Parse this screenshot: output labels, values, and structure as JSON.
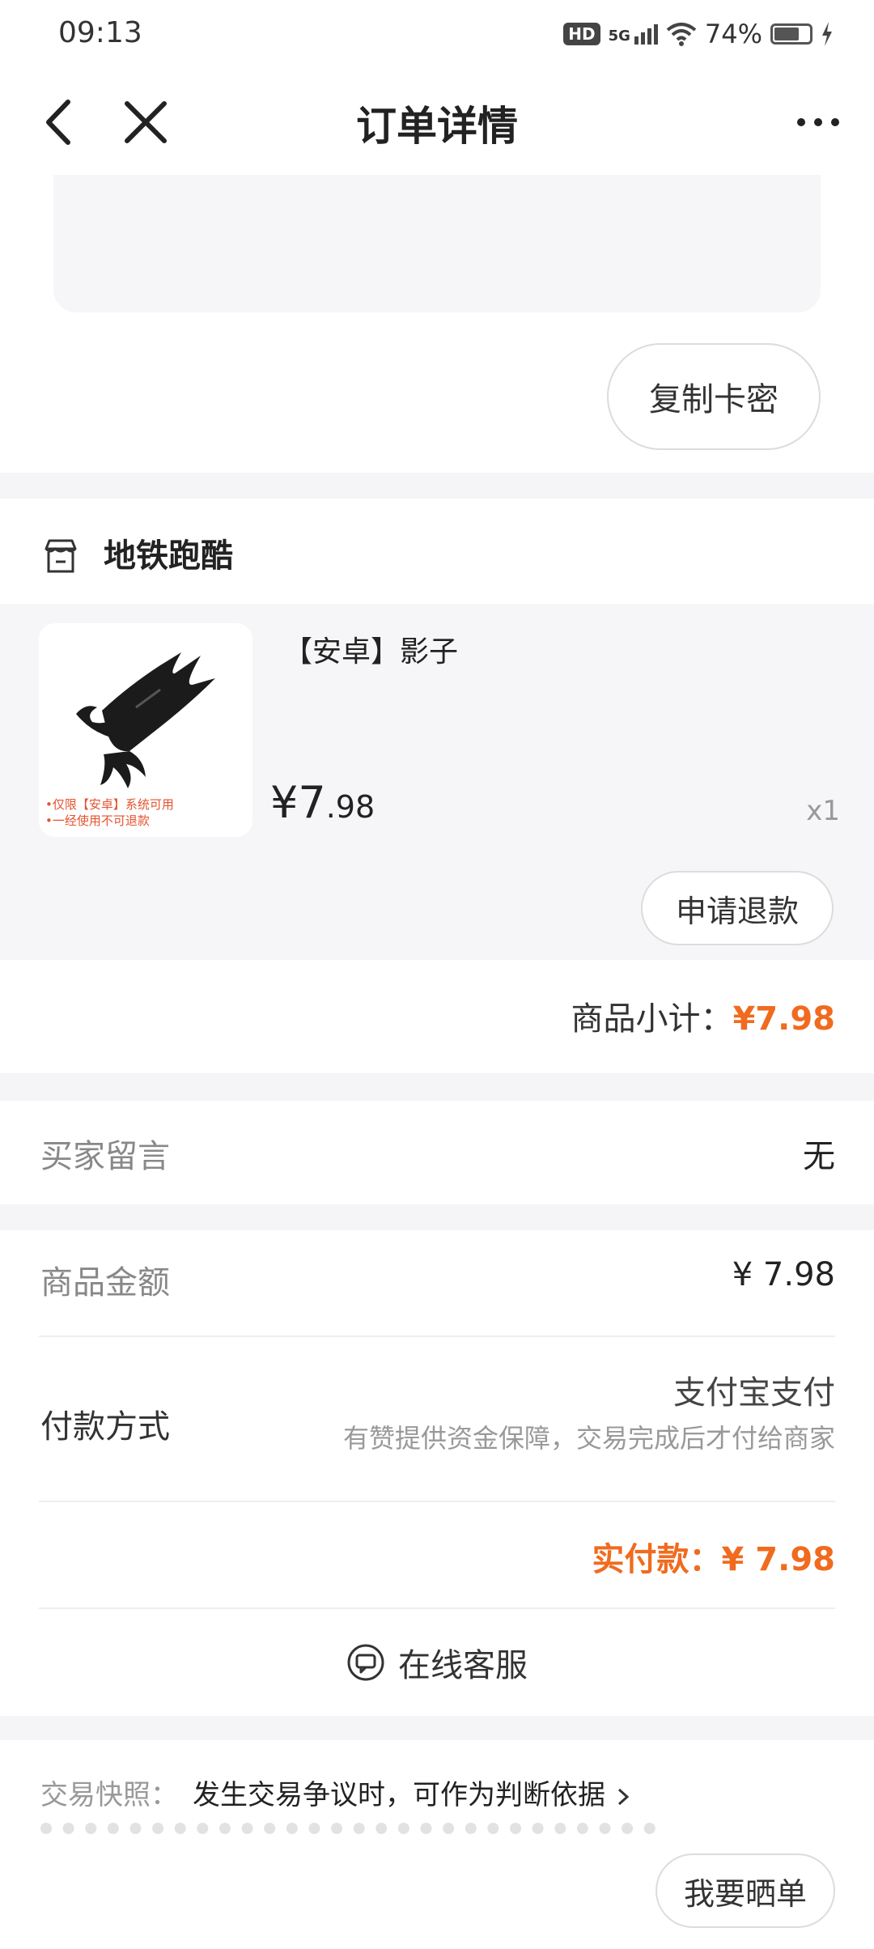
{
  "status": {
    "time": "09:13",
    "network": "5G",
    "battery": "74%",
    "battery_level": 0.74
  },
  "nav": {
    "title": "订单详情"
  },
  "card": {
    "copy_button": "复制卡密"
  },
  "shop": {
    "name": "地铁跑酷",
    "product": {
      "title": "【安卓】影子",
      "note_lines": [
        "•仅限【安卓】系统可用",
        "•一经使用不可退款"
      ],
      "price_currency": "¥",
      "price_int": "7",
      "price_dec": ".98",
      "quantity": "x1"
    },
    "refund_button": "申请退款",
    "subtotal_label": "商品小计：",
    "subtotal_value": "¥7.98"
  },
  "buyer_note": {
    "label": "买家留言",
    "value": "无"
  },
  "payment": {
    "amount_label": "商品金额",
    "amount_value": "¥ 7.98",
    "method_label": "付款方式",
    "method_value": "支付宝支付",
    "method_note": "有赞提供资金保障，交易完成后才付给商家",
    "actual_label": "实付款：",
    "actual_value": "¥ 7.98",
    "service_label": "在线客服"
  },
  "snapshot": {
    "label": "交易快照：",
    "value": "发生交易争议时，可作为判断依据",
    "share_button": "我要晒单"
  }
}
